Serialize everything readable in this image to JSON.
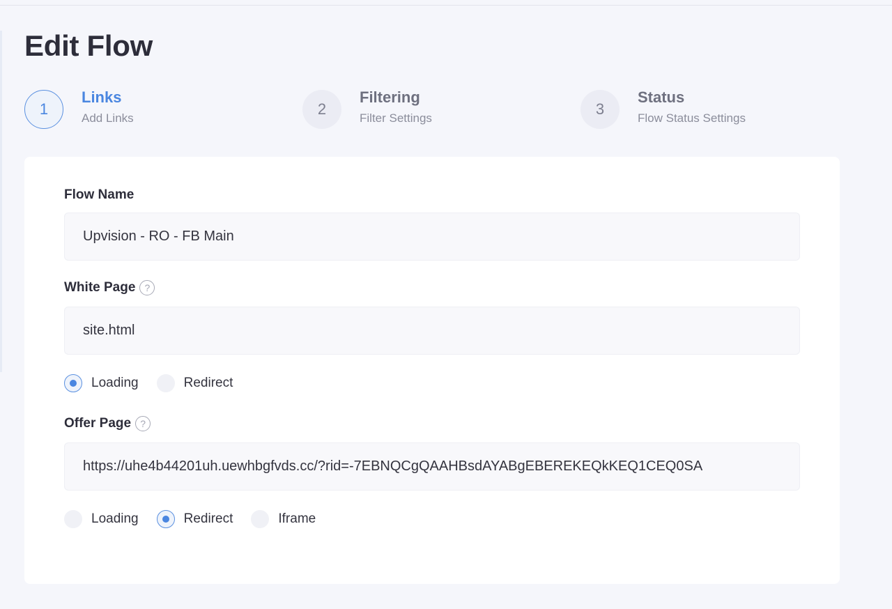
{
  "page": {
    "title": "Edit Flow"
  },
  "steps": [
    {
      "number": "1",
      "title": "Links",
      "subtitle": "Add Links",
      "active": true
    },
    {
      "number": "2",
      "title": "Filtering",
      "subtitle": "Filter Settings",
      "active": false
    },
    {
      "number": "3",
      "title": "Status",
      "subtitle": "Flow Status Settings",
      "active": false
    }
  ],
  "form": {
    "flow_name": {
      "label": "Flow Name",
      "value": "Upvision - RO - FB Main"
    },
    "white_page": {
      "label": "White Page",
      "help_icon": "?",
      "value": "site.html",
      "modes": [
        {
          "label": "Loading",
          "checked": true
        },
        {
          "label": "Redirect",
          "checked": false
        }
      ]
    },
    "offer_page": {
      "label": "Offer Page",
      "help_icon": "?",
      "value": "https://uhe4b44201uh.uewhbgfvds.cc/?rid=-7EBNQCgQAAHBsdAYABgEBEREKEQkKEQ1CEQ0SA",
      "modes": [
        {
          "label": "Loading",
          "checked": false
        },
        {
          "label": "Redirect",
          "checked": true
        },
        {
          "label": "Iframe",
          "checked": false
        }
      ]
    }
  },
  "colors": {
    "accent": "#4a86e0",
    "background": "#f5f6fb",
    "card": "#ffffff"
  }
}
